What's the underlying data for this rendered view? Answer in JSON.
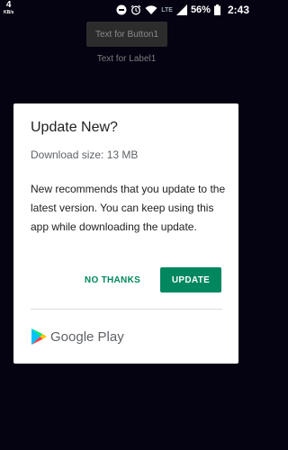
{
  "status_bar": {
    "net_speed_value": "4",
    "net_speed_unit": "KB/s",
    "network_type": "LTE",
    "battery": "56%",
    "time": "2:43",
    "icons": [
      "dnd-icon",
      "alarm-icon",
      "wifi-icon",
      "signal-icon",
      "battery-icon"
    ]
  },
  "app": {
    "button_label": "Text for Button1",
    "label_text": "Text for Label1"
  },
  "dialog": {
    "title": "Update New?",
    "download_size": "Download size: 13 MB",
    "body": "New recommends that you update to the latest version. You can keep using this app while downloading the update.",
    "no_thanks_label": "NO THANKS",
    "update_label": "UPDATE",
    "store_name": "Google Play",
    "accent_color": "#01875f"
  }
}
